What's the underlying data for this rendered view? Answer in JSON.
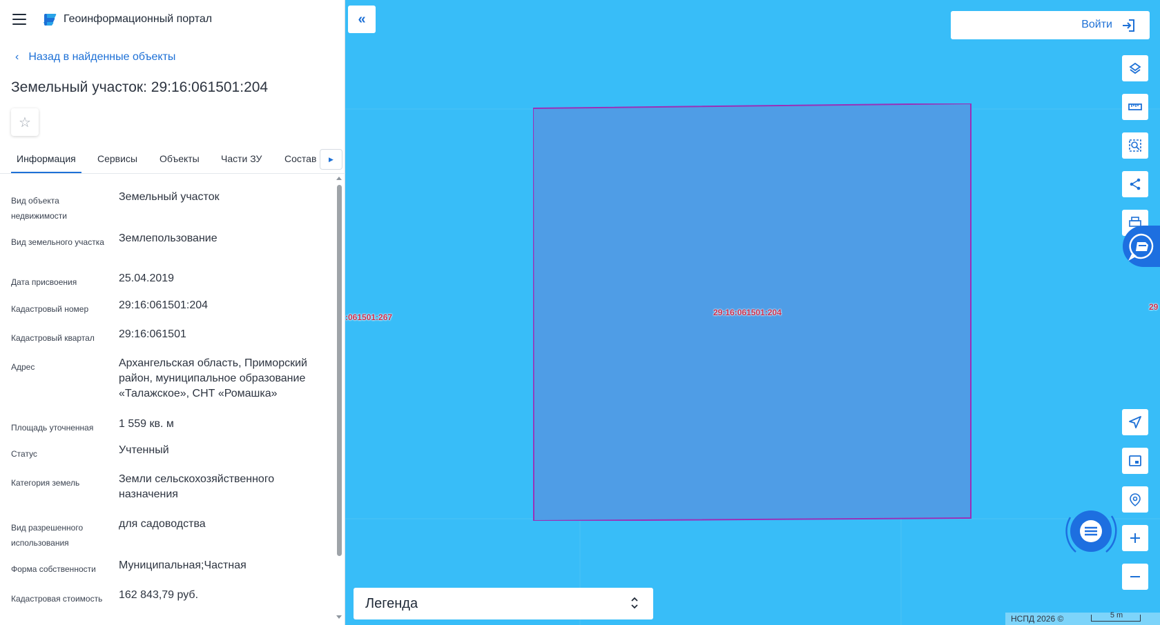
{
  "header": {
    "app_title": "Геоинформационный портал",
    "menu_icon": "hamburger-icon",
    "logo_icon": "portal-logo-icon"
  },
  "nav": {
    "back_label": "Назад в найденные объекты"
  },
  "object": {
    "title": "Земельный участок: 29:16:061501:204"
  },
  "tabs": [
    {
      "label": "Информация",
      "active": true
    },
    {
      "label": "Сервисы"
    },
    {
      "label": "Объекты"
    },
    {
      "label": "Части ЗУ"
    },
    {
      "label": "Состав"
    }
  ],
  "info": [
    {
      "label": "Вид объекта недвижимости",
      "value": "Земельный участок"
    },
    {
      "label": "Вид земельного участка",
      "value": "Землепользование"
    },
    {
      "label": "Дата присвоения",
      "value": "25.04.2019"
    },
    {
      "label": "Кадастровый номер",
      "value": "29:16:061501:204"
    },
    {
      "label": "Кадастровый квартал",
      "value": "29:16:061501"
    },
    {
      "label": "Адрес",
      "value": "Архангельская область, Приморский район, муниципальное образование «Талажское», СНТ «Ромашка»"
    },
    {
      "label": "Площадь уточненная",
      "value": "1 559 кв. м"
    },
    {
      "label": "Статус",
      "value": "Учтенный"
    },
    {
      "label": "Категория земель",
      "value": "Земли сельскохозяйственного назначения"
    },
    {
      "label": "Вид разрешенного использования",
      "value": "для садоводства"
    },
    {
      "label": "Форма собственности",
      "value": "Муниципальная;Частная"
    },
    {
      "label": "Кадастровая стоимость",
      "value": "162 843,79 руб."
    }
  ],
  "map": {
    "background_color": "#38bdf8",
    "parcel_fill": "#4f9de6",
    "parcel_stroke": "#9a2fb8",
    "parcel_label": "29:16:061501:204",
    "left_neighbor_label": ":061501:267",
    "right_neighbor_label": "29",
    "login_label": "Войти",
    "legend_label": "Легенда",
    "copyright": "НСПД 2026 ©",
    "scale_label": "5 m",
    "tools_top": [
      "layers-icon",
      "ruler-icon",
      "area-search-icon",
      "share-icon",
      "print-icon"
    ],
    "tools_bottom": [
      "navigate-icon",
      "minimap-icon",
      "location-search-icon",
      "zoom-in-icon",
      "zoom-out-icon"
    ]
  }
}
